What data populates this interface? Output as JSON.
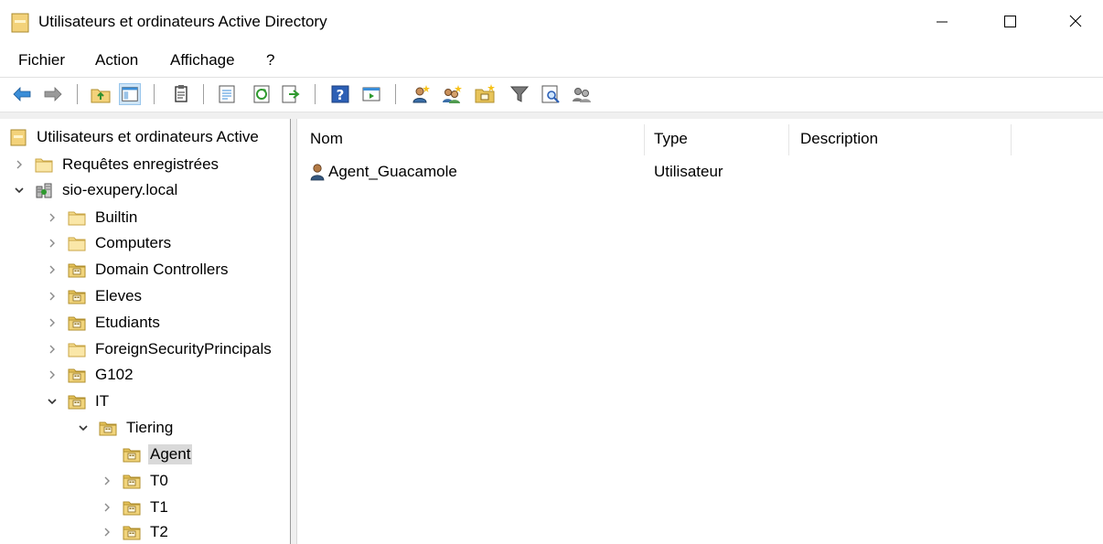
{
  "window": {
    "title": "Utilisateurs et ordinateurs Active Directory"
  },
  "menu": {
    "items": [
      "Fichier",
      "Action",
      "Affichage",
      "?"
    ]
  },
  "toolbar": {
    "buttons": [
      "back-arrow-icon",
      "forward-arrow-icon",
      "up-folder-icon",
      "show-tree-icon",
      "copy-icon",
      "properties-icon",
      "refresh-icon",
      "export-list-icon",
      "help-icon",
      "console-view-icon",
      "new-user-icon",
      "new-group-icon",
      "new-ou-icon",
      "filter-icon",
      "find-icon",
      "delegate-icon"
    ]
  },
  "tree": {
    "root": "Utilisateurs et ordinateurs Active",
    "saved_queries": "Requêtes enregistrées",
    "domain": "sio-exupery.local",
    "containers": [
      "Builtin",
      "Computers",
      "Domain Controllers",
      "Eleves",
      "Etudiants",
      "ForeignSecurityPrincipals",
      "G102",
      "IT"
    ],
    "it_children": {
      "tiering": "Tiering",
      "tiering_children": [
        "Agent",
        "T0",
        "T1",
        "T2"
      ]
    },
    "selected": "Agent"
  },
  "list": {
    "columns": [
      "Nom",
      "Type",
      "Description"
    ],
    "rows": [
      {
        "name": "Agent_Guacamole",
        "type": "Utilisateur",
        "description": ""
      }
    ]
  },
  "colors": {
    "accent": "#2a7fd4",
    "selection": "#d9d9d9",
    "folder": "#f3d27a",
    "ou_folder": "#e6c45a"
  }
}
